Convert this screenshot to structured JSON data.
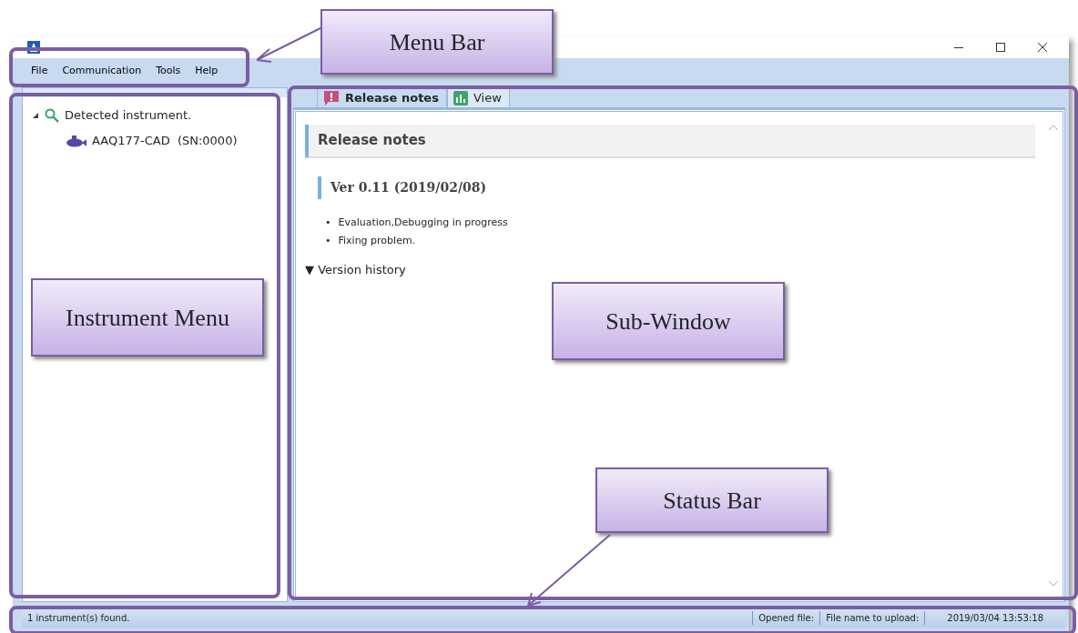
{
  "menu_bar": {
    "items": [
      "File",
      "Communication",
      "Tools",
      "Help"
    ]
  },
  "instrument_tree": [
    {
      "label": "Detected instrument.",
      "expanded": true,
      "children": [
        {
          "label": "AAQ177-CAD  (SN:0000)"
        }
      ]
    }
  ],
  "tabs": [
    {
      "label": "Release notes",
      "kind": "notes",
      "selected": true
    },
    {
      "label": "View",
      "kind": "chart",
      "selected": false
    }
  ],
  "document": {
    "heading": "Release notes",
    "version": "Ver 0.11 (2019/02/08)",
    "bullet": "•",
    "items": [
      "Evaluation,Debugging in progress",
      "Fixing problem."
    ],
    "history": "▼ Version history"
  },
  "status_bar": [
    "1 instrument(s) found.",
    "Opened file:",
    "File name to upload:",
    "2019/03/04 13:53:18"
  ],
  "annotations": [
    {
      "label": "Menu Bar"
    },
    {
      "label": "Instrument Menu"
    },
    {
      "label": "Sub-Window"
    },
    {
      "label": "Status Bar"
    }
  ]
}
